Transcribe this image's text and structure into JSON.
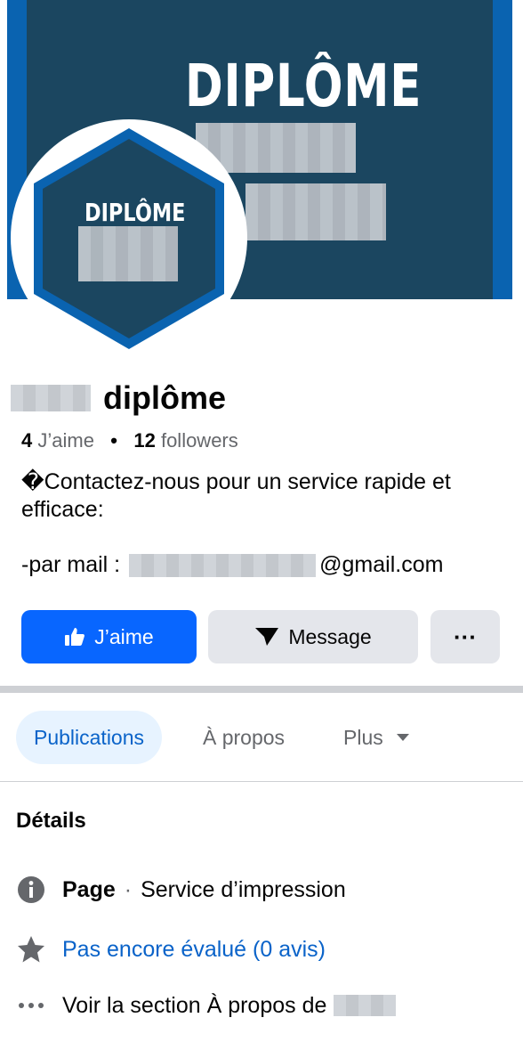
{
  "cover": {
    "title": "DIPLÔME"
  },
  "avatar": {
    "title": "DIPLÔME"
  },
  "profile": {
    "name_suffix": "diplôme",
    "likes_count": "4",
    "likes_label": "J’aime",
    "separator": "•",
    "followers_count": "12",
    "followers_label": "followers"
  },
  "bio": {
    "line": "�Contactez-nous pour un service rapide et efficace:",
    "mail_prefix": "-par mail :",
    "mail_suffix": "@gmail.com"
  },
  "actions": {
    "like_label": "J’aime",
    "message_label": "Message",
    "more_label": "···"
  },
  "tabs": [
    {
      "label": "Publications"
    },
    {
      "label": "À propos"
    },
    {
      "label": "Plus"
    }
  ],
  "details": {
    "title": "Détails",
    "page_label": "Page",
    "page_sep": "·",
    "page_category": "Service d’impression",
    "rating": "Pas encore évalué (0 avis)",
    "about_link": "Voir la section À propos de"
  },
  "colors": {
    "primary": "#0866ff",
    "link": "#0a63c9",
    "cover_bg": "#1b4660",
    "cover_border": "#0a63b0",
    "button_grey": "#e4e6eb"
  },
  "icons": [
    "thumbs-up-icon",
    "messenger-icon",
    "more-icon",
    "chevron-down-icon",
    "info-icon",
    "star-icon",
    "dots-icon"
  ]
}
